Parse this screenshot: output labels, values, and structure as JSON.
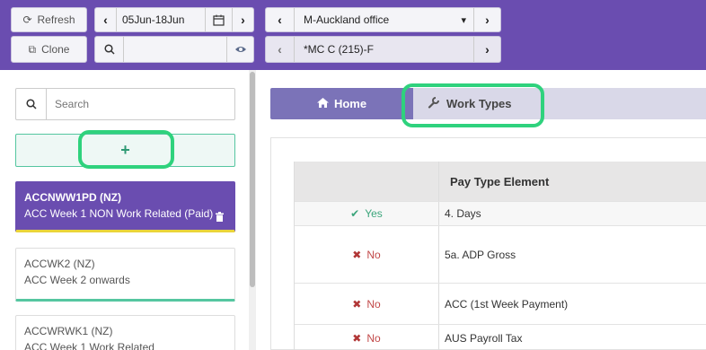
{
  "toolbar": {
    "refresh_label": "Refresh",
    "clone_label": "Clone",
    "date_range": "05Jun-18Jun",
    "search_value": "",
    "location": "M-Auckland office",
    "employee": "*MC C (215)-F"
  },
  "sidebar": {
    "search_placeholder": "Search",
    "add_label": "+",
    "items": [
      {
        "code": "ACCNWW1PD (NZ)",
        "desc": "ACC Week 1 NON Work Related (Paid)"
      },
      {
        "code": "ACCWK2 (NZ)",
        "desc": "ACC Week 2 onwards"
      },
      {
        "code": "ACCWRWK1 (NZ)",
        "desc": "ACC Week 1 Work Related"
      }
    ]
  },
  "tabs": {
    "home_label": "Home",
    "work_types_label": "Work Types"
  },
  "table": {
    "header": "Pay Type Element",
    "rows": [
      {
        "status": "Yes",
        "element": "4. Days"
      },
      {
        "status": "No",
        "element": "5a. ADP Gross"
      },
      {
        "status": "No",
        "element": "ACC (1st Week Payment)"
      },
      {
        "status": "No",
        "element": "AUS Payroll Tax"
      }
    ]
  },
  "colors": {
    "brand": "#6a4db0",
    "highlight": "#2fd27d",
    "accent": "#55c6a0"
  }
}
